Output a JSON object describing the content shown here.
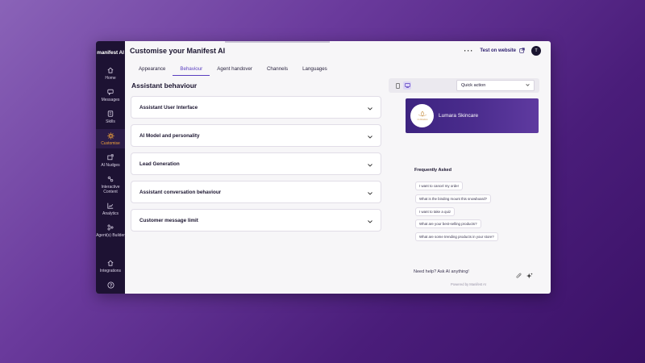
{
  "app": {
    "brand": "manifest AI",
    "page_title": "Customise your Manifest AI",
    "test_link": "Test on website",
    "avatar_initial": "T"
  },
  "sidebar": {
    "items": [
      {
        "label": "Home",
        "icon": "home-icon"
      },
      {
        "label": "Messages",
        "icon": "messages-icon"
      },
      {
        "label": "Skills",
        "icon": "skills-icon"
      },
      {
        "label": "Customise",
        "icon": "customise-icon",
        "active": true
      },
      {
        "label": "AI Nudges",
        "icon": "nudge-icon"
      },
      {
        "label": "Interactive Content",
        "icon": "interactive-icon"
      },
      {
        "label": "Analytics",
        "icon": "analytics-icon"
      },
      {
        "label": "Agent(s) Builder",
        "icon": "agent-builder-icon"
      }
    ],
    "bottom": [
      {
        "label": "Integrations",
        "icon": "integrations-icon"
      }
    ]
  },
  "tabs": [
    {
      "label": "Appearance"
    },
    {
      "label": "Behaviour",
      "active": true
    },
    {
      "label": "Agent handover"
    },
    {
      "label": "Channels"
    },
    {
      "label": "Languages"
    }
  ],
  "behaviour": {
    "title": "Assistant behaviour",
    "sections": [
      {
        "label": "Assistant User Interface"
      },
      {
        "label": "AI Model and personality"
      },
      {
        "label": "Lead Generation"
      },
      {
        "label": "Assistant conversation behaviour"
      },
      {
        "label": "Customer message limit"
      }
    ]
  },
  "preview": {
    "mode_select": "Quick action",
    "store_name": "Lumara Skincare",
    "logo_text": "LUMARA",
    "faq_title": "Frequently Asked",
    "faq": [
      "I want to cancel my order",
      "What is the binding mount this snowboard?",
      "I want to take a quiz",
      "What are your best-selling products?",
      "What are some trending products in your store?"
    ],
    "input_placeholder": "Need help? Ask AI anything!",
    "powered_by": "Powered by Manifest AI"
  },
  "colors": {
    "accent": "#5a3fc0",
    "sidebar_bg": "#1d1233",
    "active_nav": "#f2a33a"
  }
}
